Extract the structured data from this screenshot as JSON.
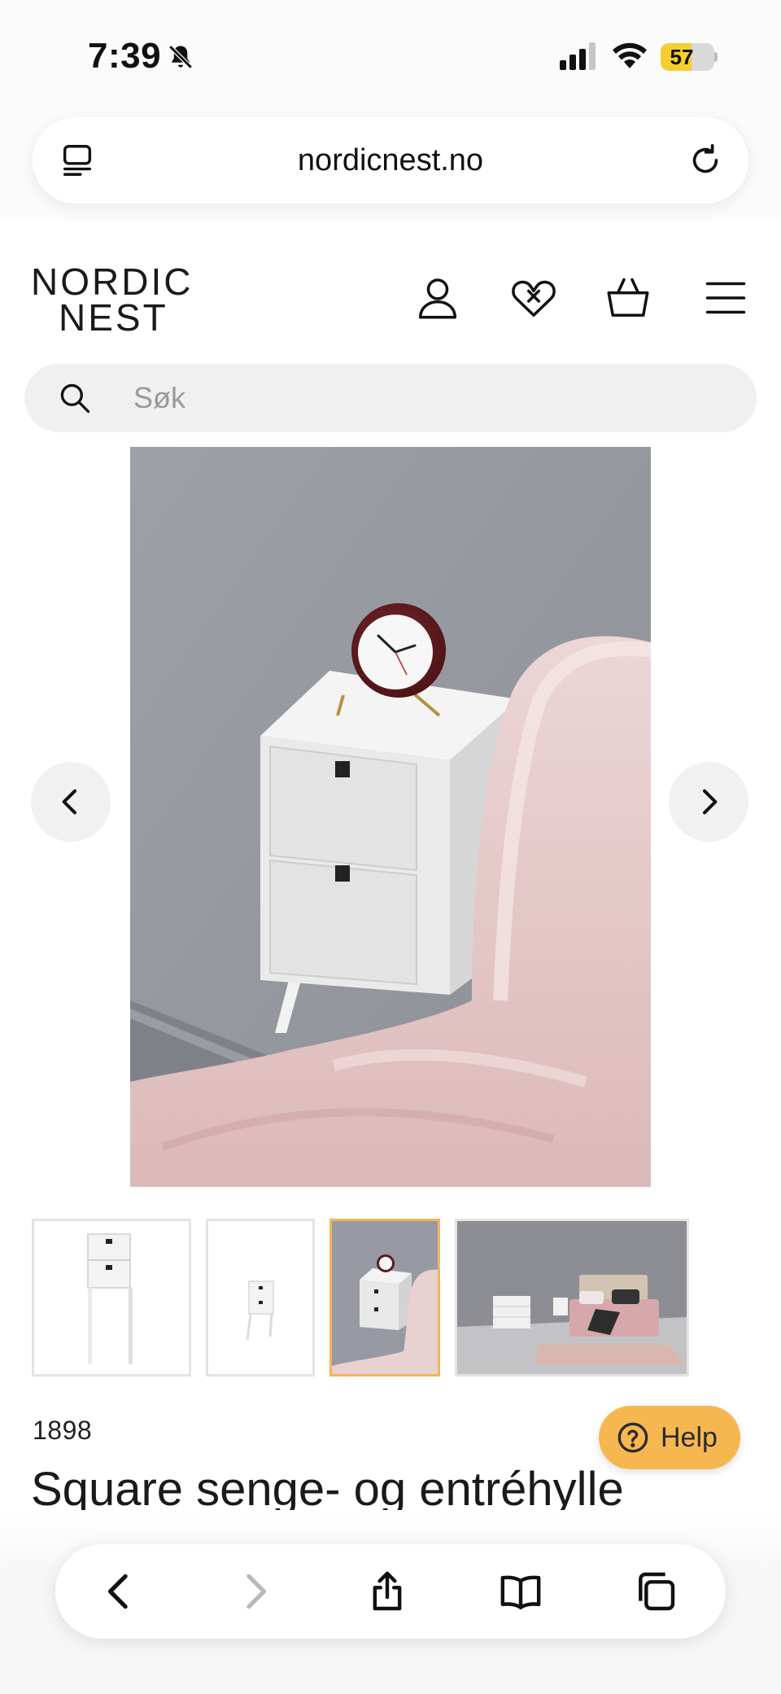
{
  "status_bar": {
    "time": "7:39",
    "battery_level": "57",
    "battery_fraction": 0.57,
    "icons": [
      "bell-muted-icon",
      "cellular-signal-icon",
      "wifi-icon",
      "battery-icon"
    ]
  },
  "browser": {
    "url": "nordicnest.no",
    "icons": [
      "tab-view-icon",
      "reload-icon"
    ]
  },
  "site_header": {
    "logo_line1": "NORDIC",
    "logo_line2": "NEST",
    "icons": [
      "account-icon",
      "wishlist-heart-icon",
      "basket-icon",
      "menu-icon"
    ]
  },
  "search": {
    "placeholder": "Søk"
  },
  "gallery": {
    "active_index": 2,
    "thumbnails": [
      "Shelf on white background",
      "Small shelf on white background",
      "Shelf with clock beside bed",
      "Bedroom scene"
    ],
    "icons": [
      "chevron-left-icon",
      "chevron-right-icon"
    ]
  },
  "product": {
    "brand": "1898",
    "title": "Square senge- og entréhylle"
  },
  "help": {
    "label": "Help"
  },
  "toolbar": {
    "icons": [
      "back-icon",
      "forward-icon",
      "share-icon",
      "bookmarks-icon",
      "tabs-icon"
    ]
  },
  "colors": {
    "accent": "#f6b750",
    "active_thumb_border": "#f4b654",
    "search_bg": "#f0f0f0",
    "battery": "#f5cf2f"
  }
}
